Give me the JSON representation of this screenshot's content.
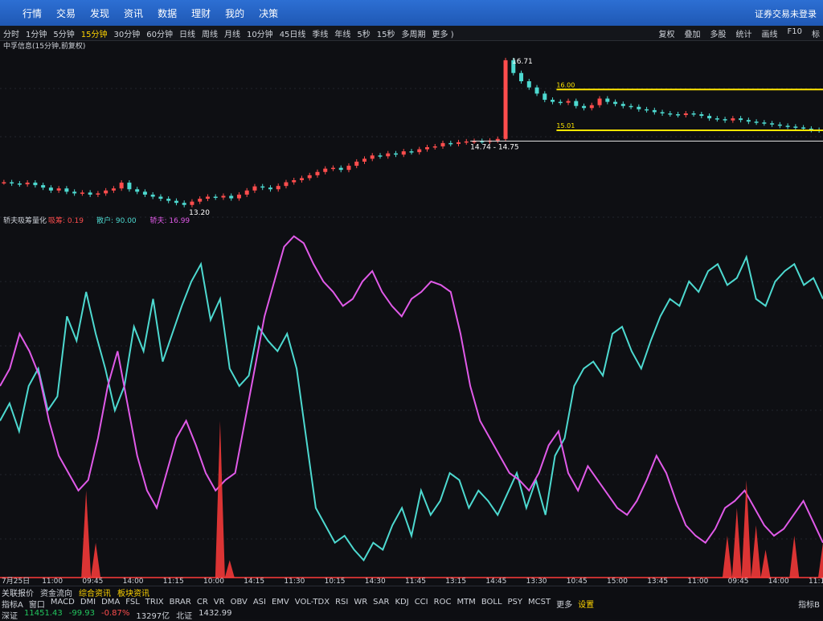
{
  "menu": [
    "行情",
    "交易",
    "发现",
    "资讯",
    "数据",
    "理财",
    "我的",
    "决策"
  ],
  "login_status": "证券交易未登录",
  "timeframes": [
    "分时",
    "1分钟",
    "5分钟",
    "15分钟",
    "30分钟",
    "60分钟",
    "日线",
    "周线",
    "月线",
    "10分钟",
    "45日线",
    "季线",
    "年线",
    "5秒",
    "15秒",
    "多周期",
    "更多 )"
  ],
  "active_timeframe": "15分钟",
  "toolbar_right": [
    "复权",
    "叠加",
    "多股",
    "统计",
    "画线",
    "F10",
    "标"
  ],
  "stock_title": "中孚信息(15分钟,前复权)",
  "indicator": {
    "name": "轿夫吸筹量化",
    "items": [
      {
        "label": "吸筹: 0.19",
        "color": "#ff4d4d"
      },
      {
        "label": "散户: 90.00",
        "color": "#4dd9d0"
      },
      {
        "label": "轿夫: 16.99",
        "color": "#e05ae8"
      }
    ]
  },
  "price_annotations": {
    "high": "16.71",
    "low": "13.20",
    "range": "14.74 - 14.75",
    "line_upper": "16.00",
    "line_lower": "15.01"
  },
  "time_axis": [
    "7月25日",
    "11:00",
    "09:45",
    "14:00",
    "11:15",
    "10:00",
    "14:15",
    "11:30",
    "10:15",
    "14:30",
    "11:45",
    "13:15",
    "14:45",
    "13:30",
    "10:45",
    "15:00",
    "13:45",
    "11:00",
    "09:45",
    "14:00",
    "11:15"
  ],
  "tabs_row": [
    "指标A",
    "窗口",
    "MACD",
    "DMI",
    "DMA",
    "FSL",
    "TRIX",
    "BRAR",
    "CR",
    "VR",
    "OBV",
    "ASI",
    "EMV",
    "VOL-TDX",
    "RSI",
    "WR",
    "SAR",
    "KDJ",
    "CCI",
    "ROC",
    "MTM",
    "BOLL",
    "PSY",
    "MCST",
    "更多",
    "设置"
  ],
  "active_tab": "设置",
  "links_row": [
    "关联报价",
    "资金流向",
    "综合资讯",
    "板块资讯"
  ],
  "index_row": [
    {
      "name": "深证",
      "value": "11451.43",
      "change": "-99.93",
      "pct": "-0.87%",
      "vol": "13297亿"
    },
    {
      "name": "北证",
      "value": "1432.99"
    }
  ],
  "indicator_b": "指标B",
  "chart_data": {
    "type": "line",
    "title": "中孚信息(15分钟,前复权)",
    "price_series": {
      "name": "K线",
      "values": [
        13.75,
        13.72,
        13.7,
        13.74,
        13.68,
        13.62,
        13.55,
        13.6,
        13.52,
        13.48,
        13.5,
        13.45,
        13.48,
        13.55,
        13.6,
        13.74,
        13.58,
        13.52,
        13.45,
        13.4,
        13.35,
        13.3,
        13.25,
        13.2,
        13.28,
        13.35,
        13.4,
        13.38,
        13.42,
        13.36,
        13.45,
        13.55,
        13.65,
        13.62,
        13.58,
        13.66,
        13.75,
        13.8,
        13.85,
        13.92,
        14.0,
        14.08,
        14.1,
        14.05,
        14.15,
        14.25,
        14.32,
        14.4,
        14.38,
        14.45,
        14.42,
        14.5,
        14.48,
        14.55,
        14.6,
        14.62,
        14.7,
        14.68,
        14.72,
        14.74,
        14.75,
        14.74,
        14.76,
        14.8,
        16.71,
        16.4,
        16.2,
        16.05,
        15.9,
        15.75,
        15.7,
        15.68,
        15.72,
        15.6,
        15.55,
        15.62,
        15.78,
        15.7,
        15.65,
        15.6,
        15.58,
        15.52,
        15.5,
        15.45,
        15.42,
        15.4,
        15.38,
        15.42,
        15.4,
        15.36,
        15.3,
        15.28,
        15.25,
        15.3,
        15.26,
        15.22,
        15.2,
        15.18,
        15.15,
        15.12,
        15.1,
        15.08,
        15.05,
        15.02,
        15.01
      ]
    },
    "series": [
      {
        "name": "散户",
        "color": "#4dd9d0",
        "values": [
          45,
          50,
          42,
          55,
          60,
          48,
          52,
          75,
          68,
          82,
          70,
          60,
          48,
          55,
          72,
          65,
          80,
          62,
          70,
          78,
          85,
          90,
          74,
          80,
          60,
          55,
          58,
          72,
          68,
          65,
          70,
          60,
          40,
          20,
          15,
          10,
          12,
          8,
          5,
          10,
          8,
          15,
          20,
          12,
          25,
          18,
          22,
          30,
          28,
          20,
          25,
          22,
          18,
          24,
          30,
          20,
          28,
          18,
          35,
          40,
          55,
          60,
          62,
          58,
          70,
          72,
          65,
          60,
          68,
          75,
          80,
          78,
          85,
          82,
          88,
          90,
          84,
          86,
          92,
          80,
          78,
          85,
          88,
          90,
          84,
          86,
          80
        ]
      },
      {
        "name": "轿夫",
        "color": "#e05ae8",
        "values": [
          55,
          60,
          70,
          65,
          58,
          45,
          35,
          30,
          25,
          28,
          40,
          55,
          65,
          50,
          35,
          25,
          20,
          30,
          40,
          45,
          38,
          30,
          25,
          28,
          30,
          45,
          60,
          75,
          85,
          95,
          98,
          96,
          90,
          85,
          82,
          78,
          80,
          85,
          88,
          82,
          78,
          75,
          80,
          82,
          85,
          84,
          82,
          70,
          55,
          45,
          40,
          35,
          30,
          28,
          25,
          30,
          38,
          42,
          30,
          25,
          32,
          28,
          24,
          20,
          18,
          22,
          28,
          35,
          30,
          22,
          15,
          12,
          10,
          14,
          20,
          22,
          25,
          20,
          15,
          12,
          14,
          18,
          22,
          16,
          10
        ]
      },
      {
        "name": "吸筹",
        "color": "#ff3b3b",
        "values": [
          0,
          0,
          0,
          0,
          0,
          0,
          0,
          0,
          0,
          25,
          10,
          0,
          0,
          0,
          0,
          0,
          0,
          0,
          0,
          0,
          0,
          0,
          0,
          45,
          5,
          0,
          0,
          0,
          0,
          0,
          0,
          0,
          0,
          0,
          0,
          0,
          0,
          0,
          0,
          0,
          0,
          0,
          0,
          0,
          0,
          0,
          0,
          0,
          0,
          0,
          0,
          0,
          0,
          0,
          0,
          0,
          0,
          0,
          0,
          0,
          0,
          0,
          0,
          0,
          0,
          0,
          0,
          0,
          0,
          0,
          0,
          0,
          0,
          0,
          0,
          0,
          12,
          20,
          28,
          15,
          8,
          0,
          0,
          12,
          0,
          0,
          10
        ]
      }
    ],
    "grid": true
  }
}
